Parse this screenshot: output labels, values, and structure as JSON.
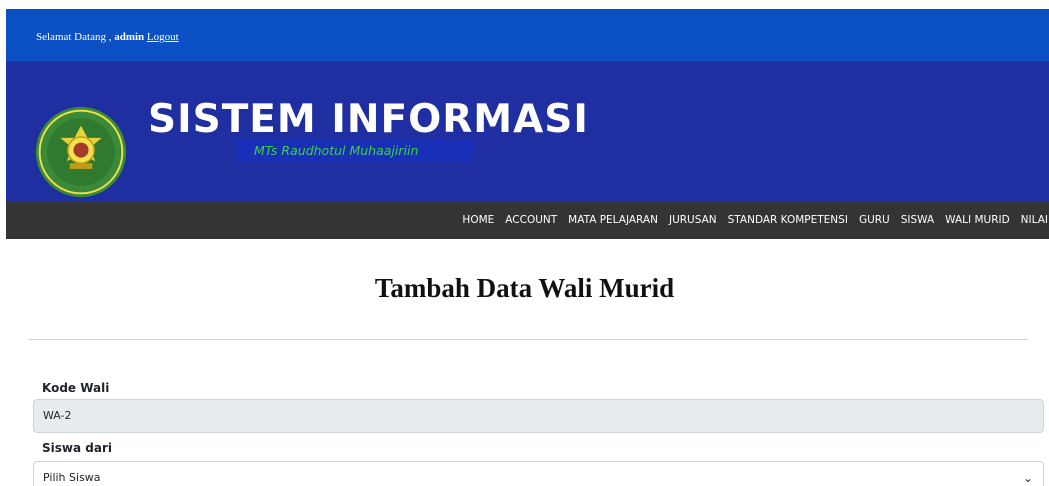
{
  "topbar": {
    "greeting": "Selamat Datang ,",
    "username": "admin",
    "logout_label": "Logout"
  },
  "banner": {
    "title": "SISTEM INFORMASI",
    "subtitle": "MTs Raudhotul Muhaajiriin",
    "logo_icon": "school-emblem-icon"
  },
  "nav": {
    "items": [
      {
        "label": "HOME"
      },
      {
        "label": "ACCOUNT"
      },
      {
        "label": "MATA PELAJARAN"
      },
      {
        "label": "JURUSAN"
      },
      {
        "label": "STANDAR KOMPETENSI"
      },
      {
        "label": "GURU"
      },
      {
        "label": "SISWA"
      },
      {
        "label": "WALI MURID"
      },
      {
        "label": "NILAI"
      }
    ]
  },
  "page": {
    "title": "Tambah Data Wali Murid"
  },
  "form": {
    "kode_wali_label": "Kode Wali",
    "kode_wali_value": "WA-2",
    "siswa_label": "Siswa dari",
    "siswa_value": "Pilih Siswa"
  },
  "colors": {
    "topbar": "#0a4fc4",
    "banner": "#1f2ea0",
    "navbar": "#343434",
    "subtitle_text": "#3dd04a"
  }
}
